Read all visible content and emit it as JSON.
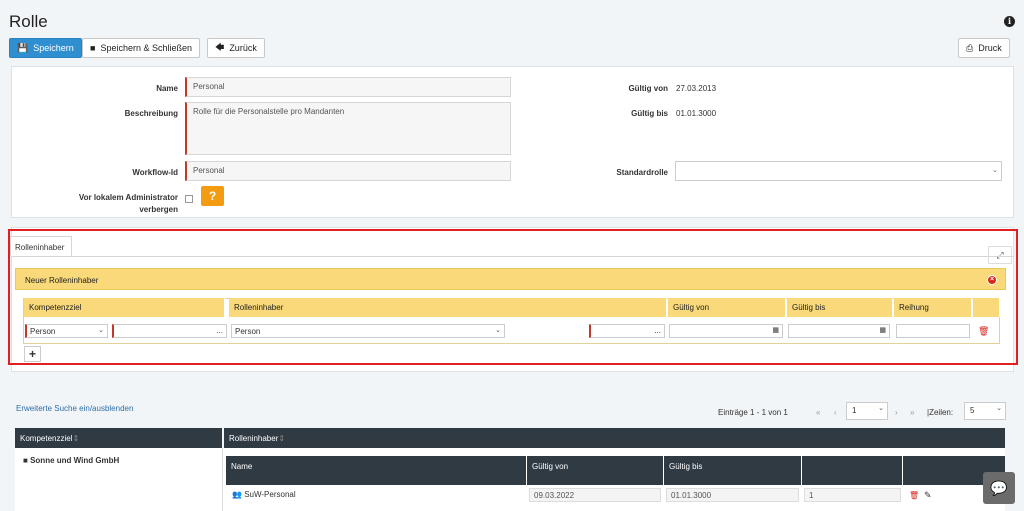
{
  "page": {
    "title": "Rolle"
  },
  "toolbar": {
    "save": "Speichern",
    "save_close": "Speichern & Schließen",
    "back": "Zurück",
    "print": "Druck"
  },
  "form": {
    "name_label": "Name",
    "name_value": "Personal",
    "desc_label": "Beschreibung",
    "desc_value": "Rolle für die Personalstelle pro Mandanten",
    "workflow_label": "Workflow-Id",
    "workflow_value": "Personal",
    "hide_label_1": "Vor lokalem Administrator",
    "hide_label_2": "verbergen",
    "help_btn": "?",
    "valid_from_label": "Gültig von",
    "valid_from_value": "27.03.2013",
    "valid_to_label": "Gültig bis",
    "valid_to_value": "01.01.3000",
    "default_role_label": "Standardrolle",
    "default_role_value": ""
  },
  "holders": {
    "tab": "Rolleninhaber",
    "new_header": "Neuer Rolleninhaber",
    "columns": [
      "Kompetenzziel",
      "Rolleninhaber",
      "Gültig von",
      "Gültig bis",
      "Reihung"
    ],
    "row": {
      "kompetenzziel": "Person",
      "rolleninhaber": "Person",
      "dots": "..."
    },
    "add": "+"
  },
  "search": {
    "toggle": "Erweiterte Suche ein/ausblenden"
  },
  "pager": {
    "entries": "Einträge 1 - 1 von 1",
    "page": "1",
    "rows_label": "|Zeilen:",
    "rows_value": "5"
  },
  "table": {
    "headers": [
      "Kompetenzziel",
      "Rolleninhaber"
    ],
    "group": "Sonne und Wind GmbH",
    "sub_headers": [
      "Name",
      "Gültig von",
      "Gültig bis",
      "",
      ""
    ],
    "sub_row": {
      "name": "SuW-Personal",
      "valid_from": "09.03.2022",
      "valid_to": "01.01.3000",
      "order": "1"
    }
  }
}
